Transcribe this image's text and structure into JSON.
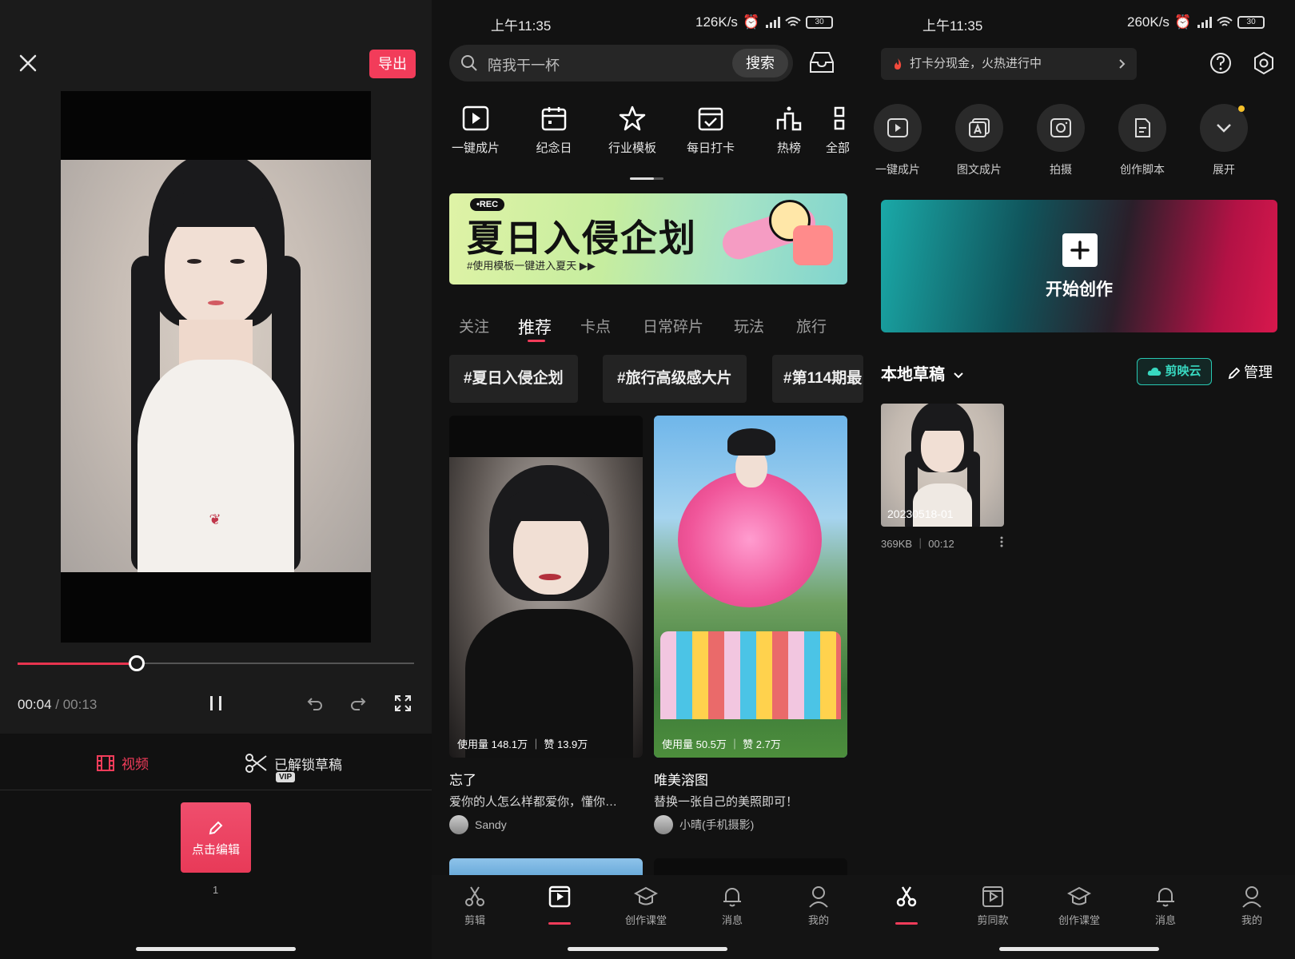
{
  "left": {
    "export_label": "导出",
    "time_current": "00:04",
    "time_total": "/ 00:13",
    "tab_video": "视频",
    "tab_drafts": "已解锁草稿",
    "vip_badge": "VIP",
    "edit_tile": "点击编辑",
    "clip_index": "1",
    "progress": 0.3,
    "accent": "#f23c5a"
  },
  "middle": {
    "status_time": "上午11:35",
    "status_speed": "126K/s",
    "battery": "30",
    "search_placeholder": "陪我干一杯",
    "search_button": "搜索",
    "quick": [
      "一键成片",
      "纪念日",
      "行业模板",
      "每日打卡",
      "热榜",
      "全部"
    ],
    "banner_title": "夏日入侵企划",
    "banner_sub": "#使用模板一键进入夏天 ▶▶",
    "banner_tag": "•REC",
    "feed_tabs": [
      "关注",
      "推荐",
      "卡点",
      "日常碎片",
      "玩法",
      "旅行"
    ],
    "chips": [
      "#夏日入侵企划",
      "#旅行高级感大片",
      "#第114期最"
    ],
    "cards": [
      {
        "stat": "使用量 148.1万 ｜ 赞 13.9万",
        "title": "忘了",
        "desc": "爱你的人怎么样都爱你，懂你…",
        "author": "Sandy"
      },
      {
        "stat": "使用量 50.5万 ｜ 赞 2.7万",
        "title": "唯美溶图",
        "desc": "替换一张自己的美照即可！",
        "author": "小晴(手机摄影)"
      }
    ],
    "nav": [
      "剪辑",
      "",
      "创作课堂",
      "消息",
      "我的"
    ]
  },
  "right": {
    "status_time": "上午11:35",
    "status_speed": "260K/s",
    "battery": "30",
    "checkin": "打卡分现金，火热进行中",
    "actions": [
      "一键成片",
      "图文成片",
      "拍摄",
      "创作脚本",
      "展开"
    ],
    "create_label": "开始创作",
    "drafts_title": "本地草稿",
    "cloud_label": "剪映云",
    "manage_label": "管理",
    "draft_name": "20230518-01",
    "draft_meta": "369KB ｜ 00:12",
    "nav": [
      "",
      "剪同款",
      "创作课堂",
      "消息",
      "我的"
    ],
    "cloud_color": "#38d8c0"
  }
}
